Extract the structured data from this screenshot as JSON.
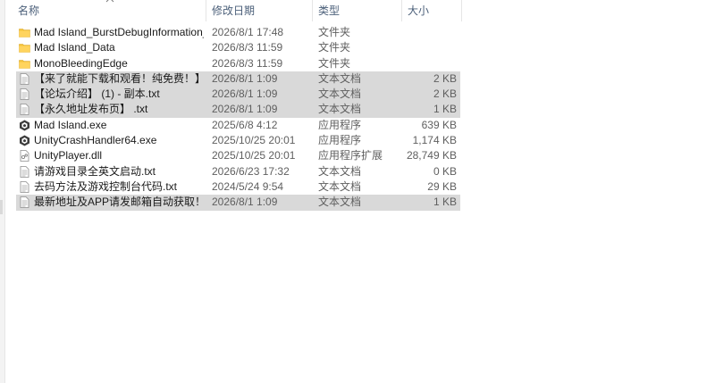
{
  "columns": {
    "name": "名称",
    "date": "修改日期",
    "type": "类型",
    "size": "大小"
  },
  "colors": {
    "selected_row": "#d9d9d9",
    "header_text": "#4c607a",
    "folder": "#f5c33b"
  },
  "files": [
    {
      "name": "Mad Island_BurstDebugInformation_...",
      "date": "2026/8/1 17:48",
      "type": "文件夹",
      "size": "",
      "icon": "folder-icon",
      "selected": false
    },
    {
      "name": "Mad Island_Data",
      "date": "2026/8/3 11:59",
      "type": "文件夹",
      "size": "",
      "icon": "folder-icon",
      "selected": false
    },
    {
      "name": "MonoBleedingEdge",
      "date": "2026/8/3 11:59",
      "type": "文件夹",
      "size": "",
      "icon": "folder-icon",
      "selected": false
    },
    {
      "name": "【来了就能下载和观看！纯免费！】 - 副...",
      "date": "2026/8/1 1:09",
      "type": "文本文档",
      "size": "2 KB",
      "icon": "text-file-icon",
      "selected": true
    },
    {
      "name": "【论坛介绍】 (1) - 副本.txt",
      "date": "2026/8/1 1:09",
      "type": "文本文档",
      "size": "2 KB",
      "icon": "text-file-icon",
      "selected": true
    },
    {
      "name": "【永久地址发布页】 .txt",
      "date": "2026/8/1 1:09",
      "type": "文本文档",
      "size": "1 KB",
      "icon": "text-file-icon",
      "selected": true
    },
    {
      "name": "Mad Island.exe",
      "date": "2025/6/8 4:12",
      "type": "应用程序",
      "size": "639 KB",
      "icon": "unity-exe-icon",
      "selected": false
    },
    {
      "name": "UnityCrashHandler64.exe",
      "date": "2025/10/25 20:01",
      "type": "应用程序",
      "size": "1,174 KB",
      "icon": "unity-exe-icon",
      "selected": false
    },
    {
      "name": "UnityPlayer.dll",
      "date": "2025/10/25 20:01",
      "type": "应用程序扩展",
      "size": "28,749 KB",
      "icon": "dll-file-icon",
      "selected": false
    },
    {
      "name": "请游戏目录全英文启动.txt",
      "date": "2026/6/23 17:32",
      "type": "文本文档",
      "size": "0 KB",
      "icon": "text-file-icon",
      "selected": false
    },
    {
      "name": "去码方法及游戏控制台代码.txt",
      "date": "2024/5/24 9:54",
      "type": "文本文档",
      "size": "29 KB",
      "icon": "text-file-icon",
      "selected": false
    },
    {
      "name": "最新地址及APP请发邮箱自动获取！！！...",
      "date": "2026/8/1 1:09",
      "type": "文本文档",
      "size": "1 KB",
      "icon": "text-file-icon",
      "selected": true
    }
  ]
}
